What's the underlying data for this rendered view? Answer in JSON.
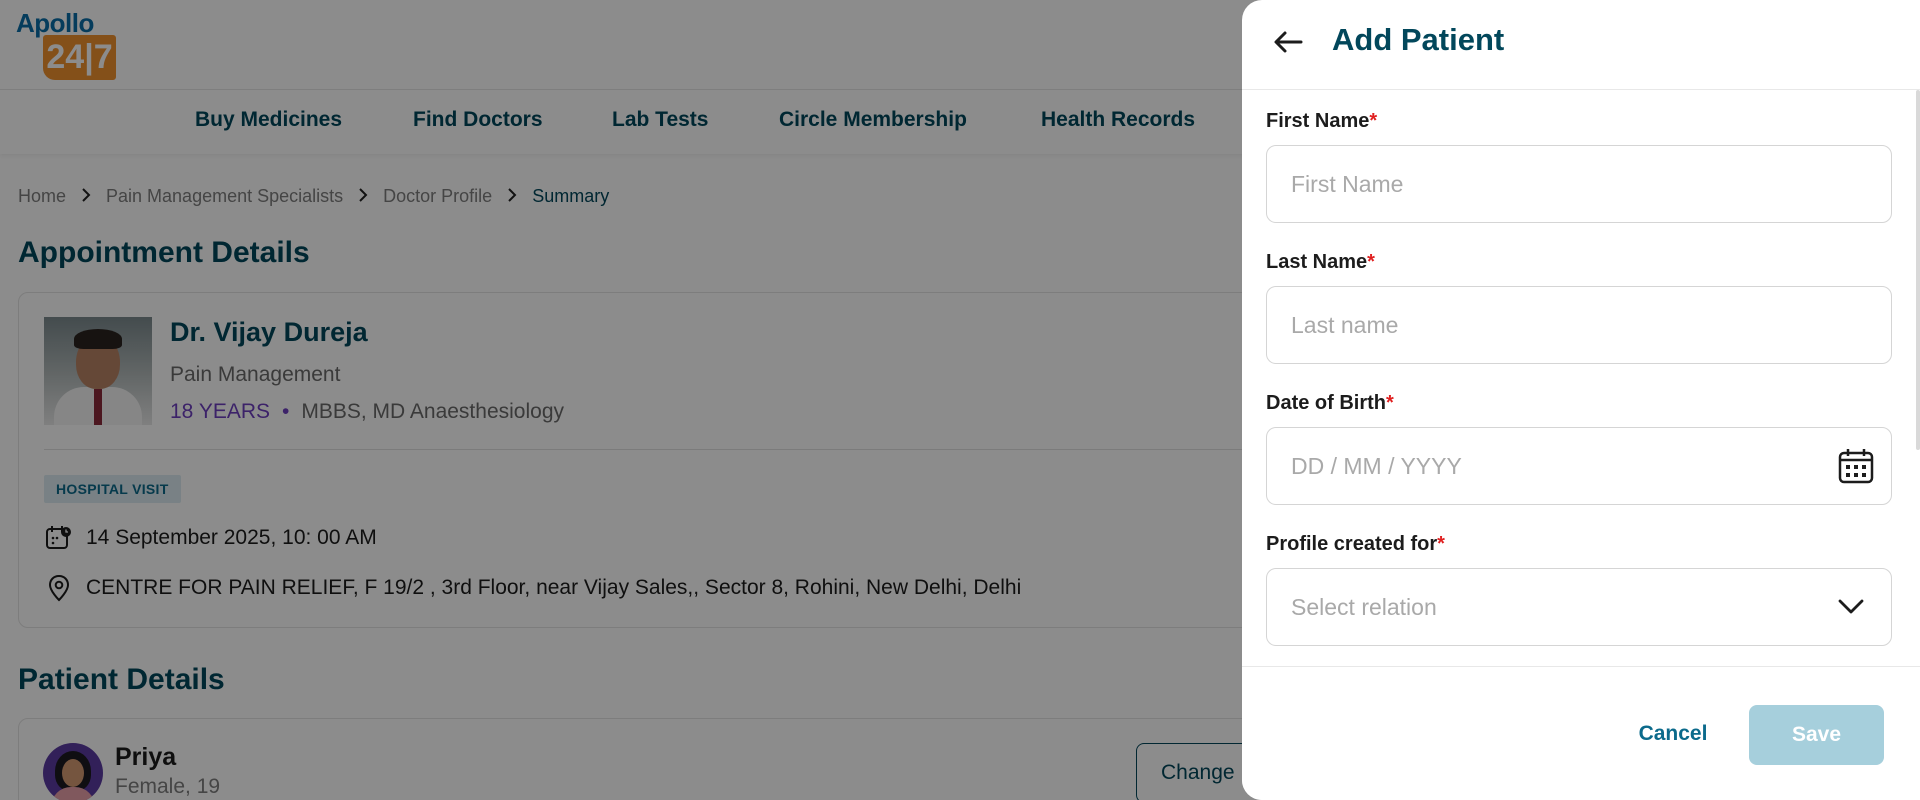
{
  "logo": {
    "top_text": "Apollo",
    "box_text": "24|7"
  },
  "nav": {
    "items": [
      "Buy Medicines",
      "Find Doctors",
      "Lab Tests",
      "Circle Membership",
      "Health Records"
    ]
  },
  "breadcrumb": {
    "items": [
      "Home",
      "Pain Management Specialists",
      "Doctor Profile",
      "Summary"
    ],
    "separator_icon": "chevron-right-icon"
  },
  "appointment": {
    "section_title": "Appointment Details",
    "doctor_name": "Dr. Vijay Dureja",
    "specialty": "Pain Management",
    "experience": "18 YEARS",
    "dot": "•",
    "qualification": "MBBS, MD Anaesthesiology",
    "visit_type": "HOSPITAL VISIT",
    "datetime": "14 September 2025, 10: 00 AM",
    "address": "CENTRE FOR PAIN RELIEF, F 19/2 , 3rd Floor, near Vijay Sales,, Sector 8, Rohini, New Delhi, Delhi"
  },
  "patient": {
    "section_title": "Patient Details",
    "name": "Priya",
    "meta": "Female, 19",
    "change_label": "Change"
  },
  "drawer": {
    "title": "Add Patient",
    "first_name": {
      "label": "First Name",
      "required_mark": "*",
      "value": "",
      "placeholder": "First Name"
    },
    "last_name": {
      "label": "Last Name",
      "required_mark": "*",
      "value": "",
      "placeholder": "Last name"
    },
    "dob": {
      "label": "Date of Birth",
      "required_mark": "*",
      "value": "",
      "placeholder": "DD / MM / YYYY"
    },
    "relation": {
      "label": "Profile created for",
      "required_mark": "*",
      "placeholder": "Select relation"
    },
    "cancel_label": "Cancel",
    "save_label": "Save"
  },
  "colors": {
    "brand_dark": "#02475b",
    "accent_purple": "#6d3fbf",
    "required_red": "#e02020",
    "save_disabled": "#a6cfdc",
    "overlay": "rgba(0,0,0,0.45)"
  }
}
